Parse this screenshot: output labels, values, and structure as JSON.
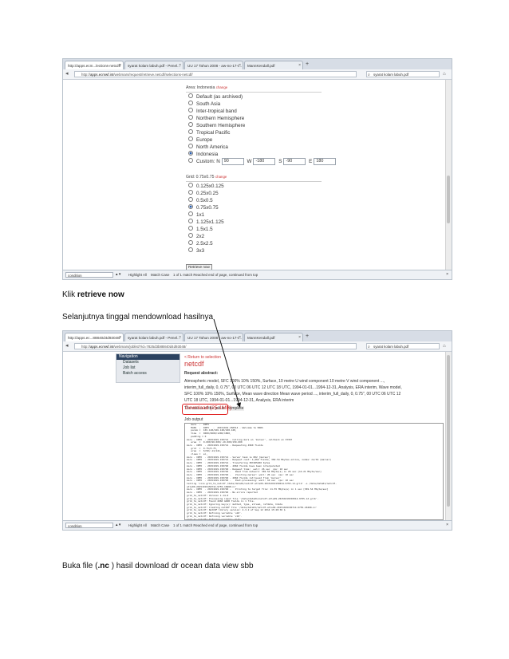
{
  "shot1": {
    "tabs": [
      {
        "label": "http://apps.ecm...lections-netcdf/"
      },
      {
        "label": "syarat kolam labuh.pdf - Penel..."
      },
      {
        "label": "UU 17 Tahun 2008 - aw-no-17-t..."
      },
      {
        "label": "MannKendall.pdf"
      }
    ],
    "url_prefix": "http://",
    "url_host": "apps.ecmwf.int",
    "url_path": "/webmars/request/retrieve.netcdf/selections-netcdf/",
    "search_value": "syarat kolam labuh.pdf",
    "area_label": "Area: Indonesia",
    "change_label": "change",
    "area_options": [
      "Default (as archived)",
      "South Asia",
      "Inter-tropical band",
      "Northern Hemisphere",
      "Southern Hemisphere",
      "Tropical Pacific",
      "Europe",
      "North America",
      "Indonesia",
      "Custom:"
    ],
    "area_selected": "Indonesia",
    "custom": {
      "n_label": "N",
      "n": "90",
      "w_label": "W",
      "w": "-180",
      "s_label": "S",
      "s": "-90",
      "e_label": "E",
      "e": "180"
    },
    "grid_label": "Grid: 0.75x0.75",
    "grid_options": [
      "0.125x0.125",
      "0.25x0.25",
      "0.5x0.5",
      "0.75x0.75",
      "1x1",
      "1.125x1.125",
      "1.5x1.5",
      "2x2",
      "2.5x2.5",
      "3x3"
    ],
    "grid_selected": "0.75x0.75",
    "retrieve_button": "Retrieve now",
    "find": {
      "value": "condition",
      "highlight": "Highlight All",
      "match_case": "Match Case",
      "status": "1 of 1 match   Reached end of page, continued from top"
    }
  },
  "caption1_prefix": "Klik ",
  "caption1_bold": "retrieve now",
  "caption2": "Selanjutnya tinggal mendownload hasilnya",
  "shot2": {
    "tabs": [
      {
        "label": "http://apps.ec...88840d4d93048/"
      },
      {
        "label": "syarat kolam labuh.pdf - Penel..."
      },
      {
        "label": "UU 17 Tahun 2008 - aw-no-17-t..."
      },
      {
        "label": "MannKendall.pdf"
      }
    ],
    "url_prefix": "http://",
    "url_host": "apps.ecmwf.int",
    "url_path": "/webmars/joblist/?id=7825d3b88840d4d93048/",
    "search_value": "syarat kolam labuh.pdf",
    "nav_header": "Navigation",
    "nav_items": [
      "Datasets",
      "Job list",
      "Batch access"
    ],
    "return_link": "< Return to selection",
    "page_title": "netcdf",
    "request_abstract": "Request abstract:",
    "abstract_lines": [
      "Atmospheric model, SFC 100% 10% 150%, Surface, 10 metre U wind component 10 metre V wind component ..., ",
      "interim_full_daily, 0, 0.75\", 00 UTC 06 UTC 12 UTC 18 UTC, 1994-01-01...1994-12-31, Analysis, ERA interim, Wave model,",
      "SFC 100% 10% 150%, Surface, Mean wave direction Mean wave period ..., interim_full_daily, 0, 0.75\", 00 UTC 06 UTC 12",
      "UTC 18 UTC, 1994-01-01...1994-12-31, Analysis, ERA interim"
    ],
    "status_prefix": "The status of the job is: ",
    "status_value": "complete",
    "download_label": "Download (25.1MB)",
    "job_output_label": "Job output",
    "log_lines": [
      "   mars  -  INFO",
      "   MARS  -  INFO   -  20151019.150514 - Welcome to MARS",
      "   param =  165.128/166.128/228.128,",
      "   time  =  0000/0600/1200/1800,",
      "   padding = 0",
      "mars - INFO  - 20151019.150714 - Calling mars on 'marser', callback on 33367",
      "   area  =  0.000/90.000/-10.000/150.000",
      "mars - INFO  - 20151019.150714 - Requesting 4960 fields",
      "   grid  =  0.75/0.75,",
      "   area  =  6/90/-11/141,",
      "   class =  ei,",
      "",
      "mars - INFO  - 20151019.150714 - Server task is 802 [marser]",
      "mars - INFO  - 20151019.150714 - Request cost: 4,960 fields, 369.54 Mbytes online, nodes: mvr01 [marser]",
      "mars - INFO  - 20151019.150714 - Transfering 387485400 bytes",
      "mars - INFO  - 20151019.150740 - 4960 fields have been interpolated",
      "mars - INFO  - 20151019.150740 - Request time:  wall: 26 sec  cpu: 10 sec",
      "mars - INFO  - 20151019.150740 -   Read from network: 369.54 Mbyte(s) in 26 sec [14.21 Mbyte/sec]",
      "mars - INFO  - 20151019.150740 -   Visiting marser: wall: 26 sec  cpu: 10 sec",
      "mars - INFO  - 20151019.150740 - 4960 fields retrieved from 'marser'",
      "mars - INFO  - 20151019.150740 -   Post-processing: wall: 10 sec  cpu: 10 sec",
      "Calling 'nice grib_to_netcdf /data/data01/netcdf-atls09-20151019150014-9755-1d.grib' -o /data/data01/netcdf-",
      "atls09-20151019150714-9755-18468.nc'",
      "mars - INFO  - 20151019.150740 -   Printing to target file: 11.55 Mbyte(s) in 1 sec [369.54 Mbyte/sec]",
      "mars - INFO  - 20151019.150740 - No errors reported",
      "grib_to_netcdf: Version 1.14.0",
      "grib_to_netcdf: Processing input file '/data/data01/netcdf-atls09-20151019150014-9755-1d.grib'.",
      "grib_to_netcdf: Found 4960 GRIB fields in 1 file.",
      "grib_to_netcdf: Ignoring key(s): method, type, stream, refdate, hdate",
      "grib_to_netcdf: Creating netCDF file '/data/data01/netcdf-atls09-20151019150714-9755-18468.nc'",
      "grib_to_netcdf: NetCDF library version: 4.3.2 of Sep 12 2014 15:49:36 $",
      "grib_to_netcdf: Defining variable 'u10'.",
      "grib_to_netcdf: Defining variable 'v10'.",
      "grib_to_netcdf: Defining variable 'mwd'.",
      "grib_to_netcdf: Defining variable 'mwp'.",
      "grib_to_netcdf: Done.",
      "End of 'nice grib_to_netcdf /data/data01/netcdf-atls09-20151019150014-9755-1d.grib' -o /data/data01/netcdf-",
      "atls09-20151019150714-9755-18468.nc'",
      "End of mars task: /tmp/tmp/netcdf-atls09.csv",
      "grib_to_netcdf: Defining variable 'mwd'.",
      "grib_to_netcdf: Defining variable 'mwp'."
    ],
    "find": {
      "value": "condition",
      "highlight": "Highlight All",
      "match_case": "Match Case",
      "status": "1 of 1 match   Reached end of page, continued from top"
    }
  },
  "caption3_prefix": "Buka file (",
  "caption3_bold": ".nc",
  "caption3_suffix": " ) hasil download dr ocean data view sbb",
  "colors": {
    "accent_red": "#cc3333",
    "nav_dark": "#2b4260",
    "highlight_box": "#e02020"
  }
}
